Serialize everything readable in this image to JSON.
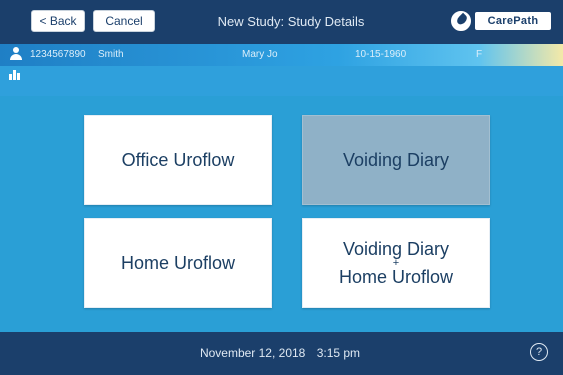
{
  "header": {
    "back_label": "< Back",
    "cancel_label": "Cancel",
    "title": "New Study: Study Details",
    "logo_text": "CarePath"
  },
  "patient": {
    "id": "1234567890",
    "last_name": "Smith",
    "first_name": "Mary Jo",
    "dob": "10-15-1960",
    "sex": "F"
  },
  "study_options": [
    {
      "label": "Office Uroflow",
      "selected": false
    },
    {
      "label": "Voiding Diary",
      "selected": true
    },
    {
      "label": "Home Uroflow",
      "selected": false
    },
    {
      "label_line1": "Voiding Diary",
      "label_plus": "+",
      "label_line2": "Home Uroflow",
      "selected": false
    }
  ],
  "footer": {
    "date": "November 12, 2018",
    "time": "3:15 pm",
    "help_symbol": "?"
  },
  "colors": {
    "header_bg": "#1b3f6b",
    "main_bg": "#2a9fd6",
    "tile_bg": "#ffffff",
    "tile_selected_bg": "#8fb1c7",
    "tile_text": "#1c3f63"
  },
  "icons": {
    "user": "user-icon",
    "chart": "chart-icon",
    "logo": "droplet-icon",
    "help": "help-icon"
  }
}
